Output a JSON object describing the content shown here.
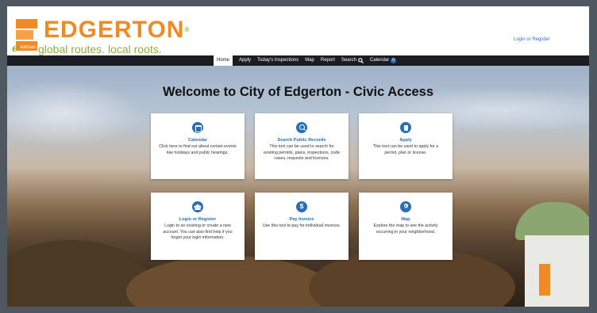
{
  "header": {
    "logo": {
      "name": "EDGERTON",
      "reg": "®",
      "tagline": "global routes. local roots.",
      "badge_letter": "e",
      "badge_text": "kansas"
    },
    "login_link": "Login or Register"
  },
  "nav": {
    "items": [
      {
        "label": "Home",
        "active": true
      },
      {
        "label": "Apply"
      },
      {
        "label": "Today's Inspections"
      },
      {
        "label": "Map"
      },
      {
        "label": "Report"
      },
      {
        "label": "Search",
        "icon": "search-icon"
      },
      {
        "label": "Calendar",
        "badge": "0"
      }
    ]
  },
  "main": {
    "welcome": "Welcome to City of Edgerton - Civic Access",
    "cards": [
      {
        "icon": "calendar-icon",
        "title": "Calendar",
        "description": "Click here to find out about certain events like holidays and public hearings."
      },
      {
        "icon": "search-icon",
        "title": "Search Public Records",
        "description": "This tool can be used to search for existing permits, plans, inspections, code cases, requests and licenses."
      },
      {
        "icon": "apply-icon",
        "title": "Apply",
        "description": "This tool can be used to apply for a permit, plan or license."
      },
      {
        "icon": "users-icon",
        "title": "Login or Register",
        "description": "Login to an existing or create a new account. You can also find help if you forgot your login information."
      },
      {
        "icon": "dollar-icon",
        "title": "Pay Invoice",
        "description": "Use this tool to pay for individual invoices."
      },
      {
        "icon": "map-pin-icon",
        "title": "Map",
        "description": "Explore the map to see the activity occurring in your neighborhood."
      }
    ]
  },
  "colors": {
    "accent": "#2a6fb5",
    "brand_orange": "#f08a24",
    "brand_green": "#8db03c",
    "nav_bg": "#1c1d22"
  }
}
